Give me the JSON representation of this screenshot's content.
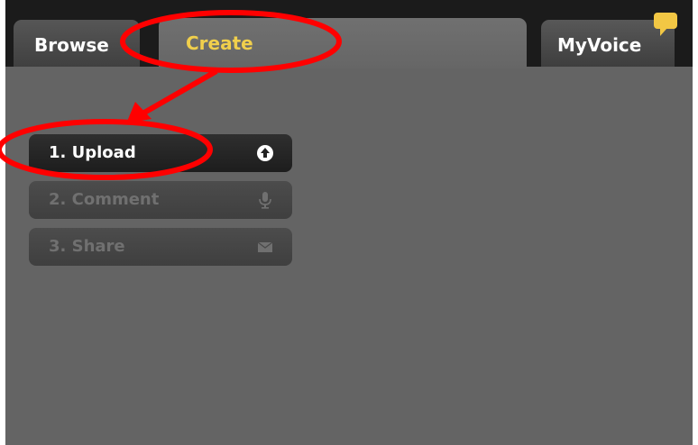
{
  "tabs": {
    "browse": "Browse",
    "create": "Create",
    "myvoice": "MyVoice"
  },
  "steps": [
    {
      "label": "1. Upload",
      "icon": "upload-icon",
      "state": "active"
    },
    {
      "label": "2. Comment",
      "icon": "microphone-icon",
      "state": "disabled"
    },
    {
      "label": "3. Share",
      "icon": "envelope-icon",
      "state": "disabled"
    }
  ],
  "colors": {
    "accent": "#f0cf4c",
    "panel": "#646464",
    "tabbar": "#1b1b1b",
    "annotation": "#ff0000"
  }
}
